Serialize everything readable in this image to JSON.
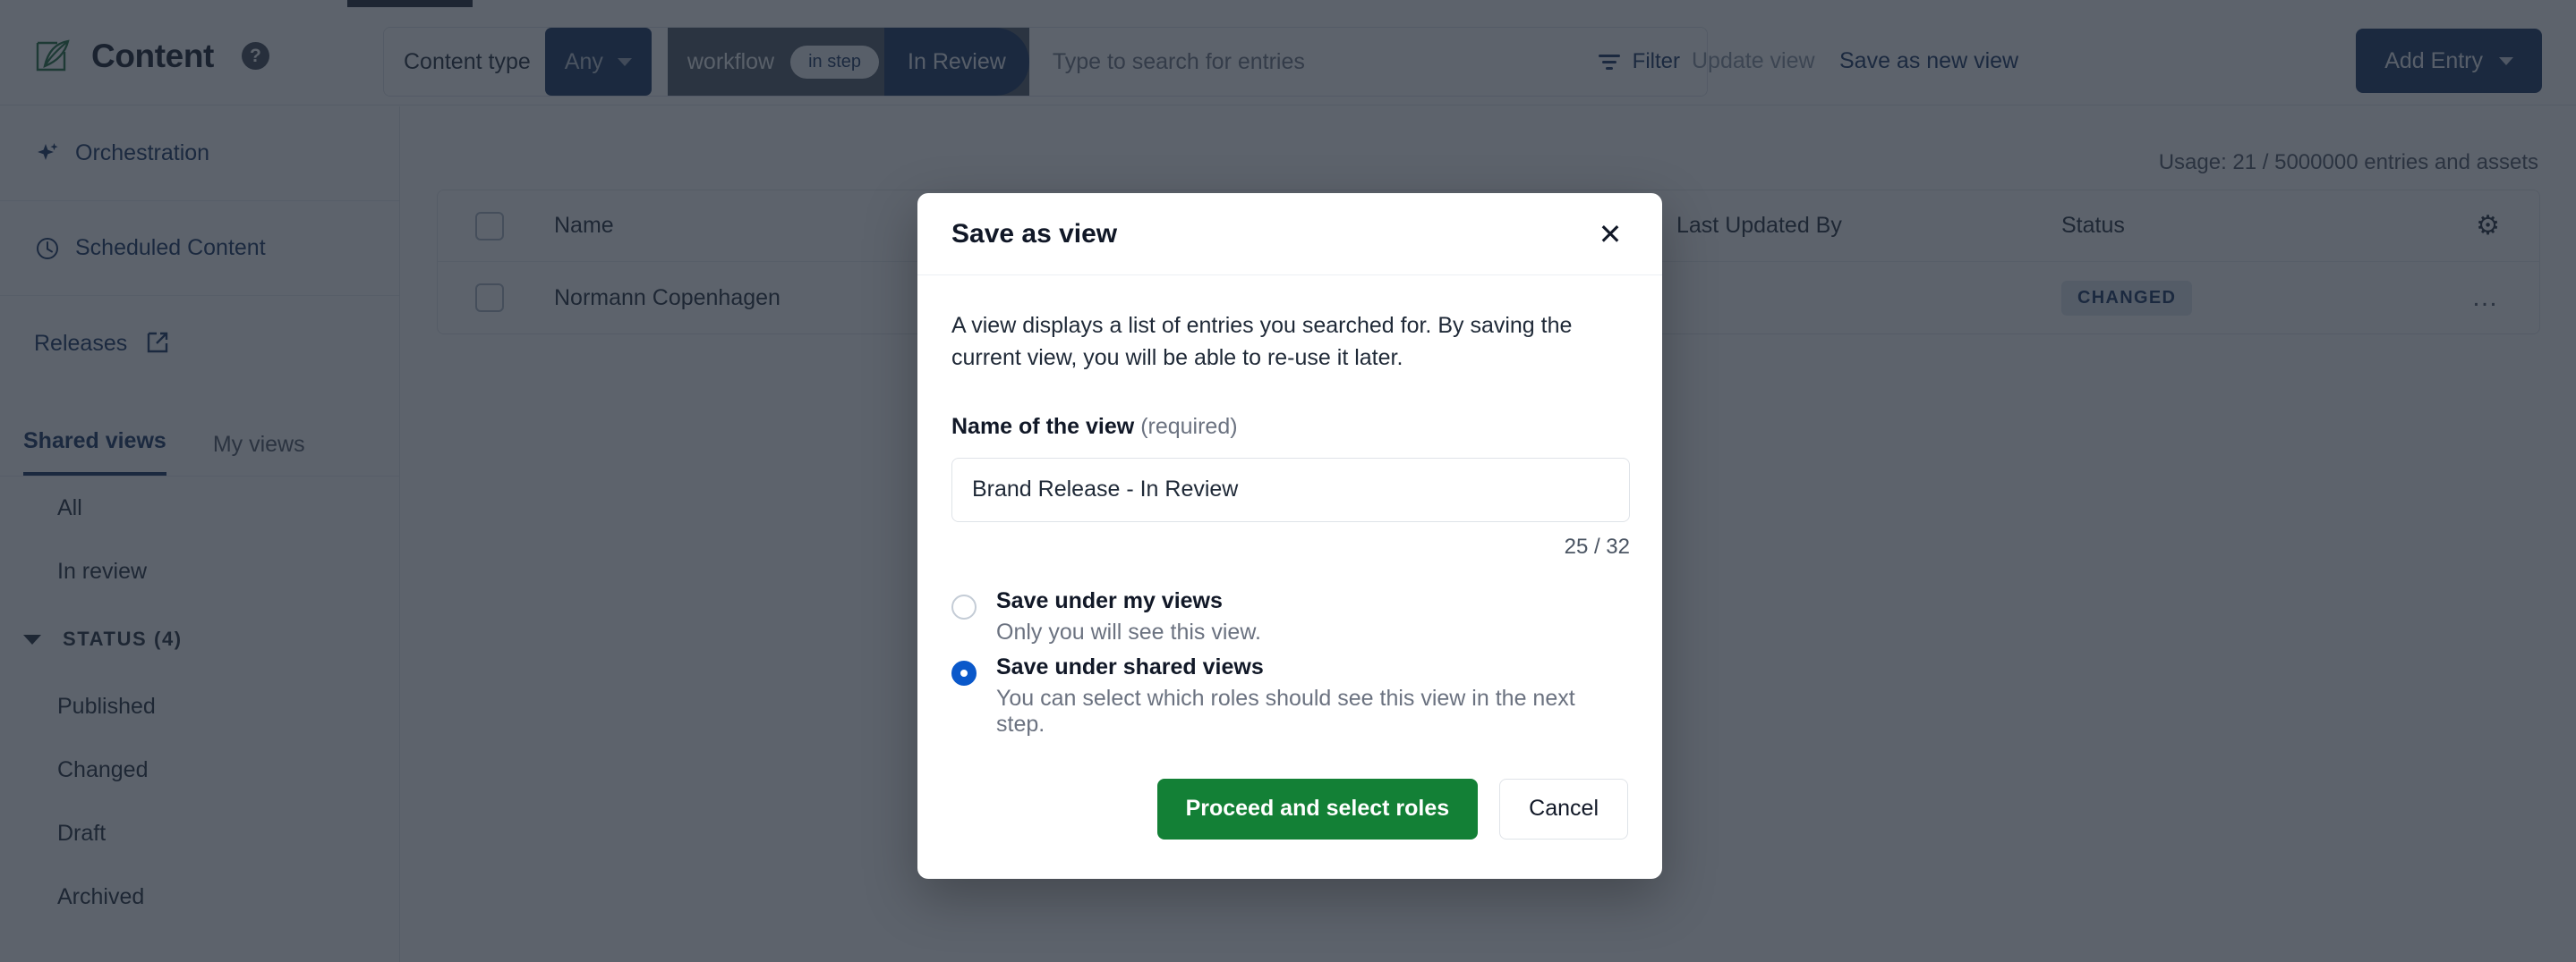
{
  "header": {
    "brand_icon": "leaf-pen-icon",
    "title": "Content",
    "help_icon": "help-circle-icon"
  },
  "toolbar": {
    "content_type_label": "Content type",
    "content_type_value": "Any",
    "workflow_label": "workflow",
    "workflow_operator": "in step",
    "workflow_value": "In Review",
    "search_placeholder": "Type to search for entries",
    "search_value": "",
    "filter_label": "Filter",
    "filter_icon": "filter-icon",
    "update_view_label": "Update view",
    "save_as_new_view_label": "Save as new view",
    "add_entry_label": "Add Entry",
    "add_entry_caret": "chevron-down-icon"
  },
  "sidebar": {
    "links": [
      {
        "label": "Orchestration",
        "icon": "sparkle-icon"
      },
      {
        "label": "Scheduled Content",
        "icon": "clock-icon"
      },
      {
        "label": "Releases",
        "icon": "external-link-icon"
      }
    ],
    "tabs": [
      {
        "label": "Shared views",
        "active": true
      },
      {
        "label": "My views",
        "active": false
      }
    ],
    "views": [
      "All",
      "In review"
    ],
    "status_group": {
      "label": "STATUS (4)",
      "chevron": "chevron-down-icon",
      "items": [
        "Published",
        "Changed",
        "Draft",
        "Archived"
      ]
    }
  },
  "main": {
    "usage": "Usage: 21 / 5000000 entries and assets",
    "table": {
      "columns": [
        "Name",
        "Last Updated By",
        "Status"
      ],
      "settings_icon": "gear-icon",
      "rows": [
        {
          "name": "Normann Copenhagen",
          "last_updated_by": "",
          "status": "CHANGED",
          "row_menu_icon": "ellipsis-icon"
        }
      ]
    }
  },
  "modal": {
    "title": "Save as view",
    "close_icon": "close-icon",
    "description": "A view displays a list of entries you searched for. By saving the current view, you will be able to re-use it later.",
    "field_label": "Name of the view",
    "field_required_note": "(required)",
    "field_value": "Brand Release - In Review",
    "field_placeholder": "",
    "counter": "25 / 32",
    "options": [
      {
        "title": "Save under my views",
        "subtitle": "Only you will see this view.",
        "selected": false
      },
      {
        "title": "Save under shared views",
        "subtitle": "You can select which roles should see this view in the next step.",
        "selected": true
      }
    ],
    "primary_button": "Proceed and select roles",
    "cancel_button": "Cancel"
  },
  "colors": {
    "brand_navy": "#13305e",
    "accent_green": "#138036",
    "radio_blue": "#0a58ca",
    "status_badge_text": "#13305e"
  }
}
